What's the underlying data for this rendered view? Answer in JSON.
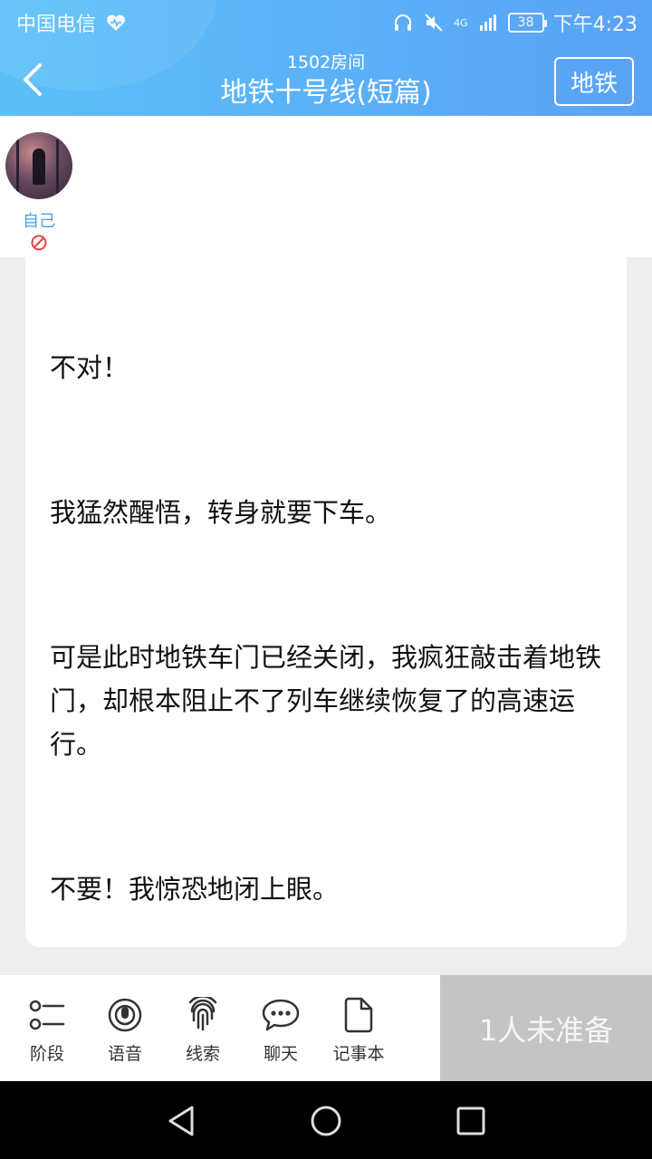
{
  "status_bar": {
    "carrier": "中国电信",
    "network": "4G",
    "battery": "38",
    "time": "下午4:23"
  },
  "header": {
    "room": "1502房间",
    "title": "地铁十号线(短篇)",
    "tag_button": "地铁"
  },
  "players": [
    {
      "name": "自己",
      "status_icon": "forbid-icon"
    }
  ],
  "story": {
    "paragraphs": [
      "不对！",
      "我猛然醒悟，转身就要下车。",
      "可是此时地铁车门已经关闭，我疯狂敲击着地铁门，却根本阻止不了列车继续恢复了的高速运行。",
      "不要！我惊恐地闭上眼。"
    ]
  },
  "toolbar": {
    "items": [
      {
        "label": "阶段",
        "icon": "stages-icon"
      },
      {
        "label": "语音",
        "icon": "voice-icon"
      },
      {
        "label": "线索",
        "icon": "fingerprint-icon"
      },
      {
        "label": "聊天",
        "icon": "chat-icon"
      },
      {
        "label": "记事本",
        "icon": "notebook-icon"
      }
    ],
    "ready_button": "1人未准备"
  },
  "colors": {
    "header_start": "#5cc0f8",
    "header_end": "#5aa2f6",
    "player_name": "#4a9ee8",
    "forbid": "#e8424a",
    "ready_bg": "#c4c4c4"
  }
}
